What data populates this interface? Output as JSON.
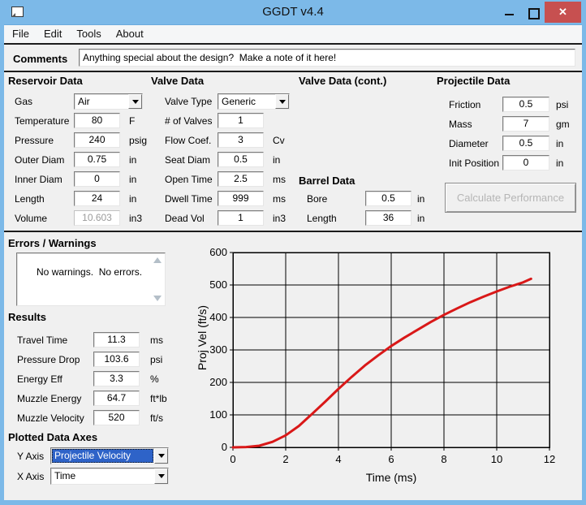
{
  "window": {
    "title": "GGDT v4.4",
    "icons": {
      "minimize": "minimize-dash",
      "maximize": "maximize-square",
      "close": "✕",
      "dropdown": "▼",
      "scroll_up": "▲",
      "scroll_down": "▼"
    },
    "close_glyph": "✕"
  },
  "menu": {
    "items": [
      "File",
      "Edit",
      "Tools",
      "About"
    ]
  },
  "comments": {
    "label": "Comments",
    "value": "Anything special about the design?  Make a note of it here!"
  },
  "reservoir": {
    "title": "Reservoir Data",
    "rows": [
      {
        "label": "Gas",
        "value": "Air",
        "type": "select"
      },
      {
        "label": "Temperature",
        "value": "80",
        "unit": "F"
      },
      {
        "label": "Pressure",
        "value": "240",
        "unit": "psig"
      },
      {
        "label": "Outer Diam",
        "value": "0.75",
        "unit": "in"
      },
      {
        "label": "Inner Diam",
        "value": "0",
        "unit": "in"
      },
      {
        "label": "Length",
        "value": "24",
        "unit": "in"
      },
      {
        "label": "Volume",
        "value": "10.603",
        "unit": "in3",
        "readonly": true
      }
    ]
  },
  "valve": {
    "title": "Valve Data",
    "rows": [
      {
        "label": "Valve Type",
        "value": "Generic",
        "type": "select"
      },
      {
        "label": "# of Valves",
        "value": "1"
      },
      {
        "label": "Flow Coef.",
        "value": "3",
        "unit": "Cv"
      },
      {
        "label": "Seat Diam",
        "value": "0.5",
        "unit": "in"
      },
      {
        "label": "Open Time",
        "value": "2.5",
        "unit": "ms"
      },
      {
        "label": "Dwell Time",
        "value": "999",
        "unit": "ms"
      },
      {
        "label": "Dead Vol",
        "value": "1",
        "unit": "in3"
      }
    ]
  },
  "valve_cont": {
    "title": "Valve Data (cont.)"
  },
  "barrel": {
    "title": "Barrel Data",
    "rows": [
      {
        "label": "Bore",
        "value": "0.5",
        "unit": "in"
      },
      {
        "label": "Length",
        "value": "36",
        "unit": "in"
      }
    ]
  },
  "projectile": {
    "title": "Projectile Data",
    "rows": [
      {
        "label": "Friction",
        "value": "0.5",
        "unit": "psi"
      },
      {
        "label": "Mass",
        "value": "7",
        "unit": "gm"
      },
      {
        "label": "Diameter",
        "value": "0.5",
        "unit": "in"
      },
      {
        "label": "Init Position",
        "value": "0",
        "unit": "in"
      }
    ],
    "button_label": "Calculate Performance"
  },
  "errors": {
    "title": "Errors / Warnings",
    "text": "No warnings.  No errors."
  },
  "results": {
    "title": "Results",
    "rows": [
      {
        "label": "Travel Time",
        "value": "11.3",
        "unit": "ms"
      },
      {
        "label": "Pressure Drop",
        "value": "103.6",
        "unit": "psi"
      },
      {
        "label": "Energy Eff",
        "value": "3.3",
        "unit": "%"
      },
      {
        "label": "Muzzle Energy",
        "value": "64.7",
        "unit": "ft*lb"
      },
      {
        "label": "Muzzle Velocity",
        "value": "520",
        "unit": "ft/s"
      }
    ]
  },
  "plotted_axes": {
    "title": "Plotted Data Axes",
    "y_label": "Y Axis",
    "y_value": "Projectile Velocity",
    "x_label": "X Axis",
    "x_value": "Time"
  },
  "colors": {
    "titlebar": "#7cb9e8",
    "close_button": "#c75050",
    "selection_blue": "#2e63c8",
    "curve_red": "#d91818",
    "grid": "#000000"
  },
  "chart_data": {
    "type": "line",
    "title": "",
    "xlabel": "Time (ms)",
    "ylabel": "Proj Vel (ft/s)",
    "xlim": [
      0,
      12
    ],
    "ylim": [
      0,
      600
    ],
    "x_ticks": [
      0,
      2,
      4,
      6,
      8,
      10,
      12
    ],
    "y_ticks": [
      0,
      100,
      200,
      300,
      400,
      500,
      600
    ],
    "grid": true,
    "legend": "none",
    "series": [
      {
        "name": "Projectile Velocity",
        "color": "#d91818",
        "x": [
          0,
          0.5,
          1,
          1.5,
          2,
          2.5,
          3,
          3.5,
          4,
          4.5,
          5,
          5.5,
          6,
          6.5,
          7,
          7.5,
          8,
          8.5,
          9,
          9.5,
          10,
          10.5,
          11,
          11.3
        ],
        "y": [
          0,
          1,
          5,
          17,
          37,
          66,
          103,
          141,
          180,
          217,
          252,
          283,
          312,
          338,
          362,
          386,
          408,
          428,
          447,
          464,
          480,
          495,
          508,
          519
        ]
      }
    ]
  }
}
